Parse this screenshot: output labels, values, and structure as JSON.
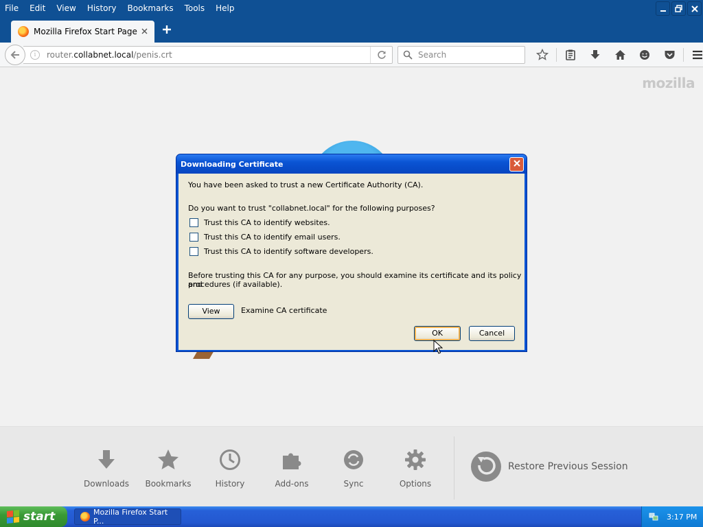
{
  "menubar": {
    "items": [
      {
        "label": "File"
      },
      {
        "label": "Edit"
      },
      {
        "label": "View"
      },
      {
        "label": "History"
      },
      {
        "label": "Bookmarks"
      },
      {
        "label": "Tools"
      },
      {
        "label": "Help"
      }
    ]
  },
  "tab": {
    "title": "Mozilla Firefox Start Page"
  },
  "navbar": {
    "url_prefix": "router.",
    "url_domain": "collabnet.local",
    "url_path": "/penis.crt",
    "search_placeholder": "Search"
  },
  "page": {
    "brand": "mozilla"
  },
  "launcher": {
    "items": [
      {
        "label": "Downloads",
        "icon": "download-icon"
      },
      {
        "label": "Bookmarks",
        "icon": "star-icon"
      },
      {
        "label": "History",
        "icon": "clock-icon"
      },
      {
        "label": "Add-ons",
        "icon": "puzzle-icon"
      },
      {
        "label": "Sync",
        "icon": "sync-icon"
      },
      {
        "label": "Options",
        "icon": "gear-icon"
      }
    ],
    "restore_label": "Restore Previous Session"
  },
  "dialog": {
    "title": "Downloading Certificate",
    "intro": "You have been asked to trust a new Certificate Authority (CA).",
    "question": "Do you want to trust \"collabnet.local\" for the following purposes?",
    "options": [
      {
        "label": "Trust this CA to identify websites.",
        "checked": false
      },
      {
        "label": "Trust this CA to identify email users.",
        "checked": false
      },
      {
        "label": "Trust this CA to identify software developers.",
        "checked": false
      }
    ],
    "advice_line1": "Before trusting this CA for any purpose, you should examine its certificate and its policy and",
    "advice_line2": "procedures (if available).",
    "view_button": "View",
    "view_caption": "Examine CA certificate",
    "ok_button": "OK",
    "cancel_button": "Cancel"
  },
  "taskbar": {
    "start_label": "start",
    "task_label": "Mozilla Firefox Start P...",
    "clock": "3:17 PM"
  }
}
